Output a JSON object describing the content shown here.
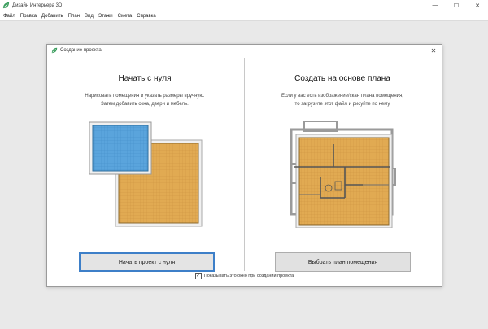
{
  "app": {
    "title": "Дизайн Интерьера 3D",
    "window_buttons": {
      "minimize": "—",
      "maximize": "☐",
      "close": "✕"
    }
  },
  "menu": {
    "items": [
      "Файл",
      "Правка",
      "Добавить",
      "План",
      "Вид",
      "Этажи",
      "Смета",
      "Справка"
    ]
  },
  "dialog": {
    "title": "Создание проекта",
    "close": "✕",
    "left": {
      "heading": "Начать с нуля",
      "desc_line1": "Нарисовать помещения и указать размеры вручную.",
      "desc_line2": "Затем добавить окна, двери и мебель.",
      "button": "Начать проект с нуля"
    },
    "right": {
      "heading": "Создать на основе плана",
      "desc_line1": "Если у вас есть изображение/скан плана помещения,",
      "desc_line2": "то загрузите этот файл и рисуйте по нему",
      "button": "Выбрать план помещения"
    },
    "checkbox": {
      "checked": true,
      "mark": "✓",
      "label": "Показывать это окно при создании проекта"
    }
  },
  "colors": {
    "room_fill": "#e1aa52",
    "room_fill_blue": "#5aa4dc",
    "accent": "#3d7fc8",
    "logo_green": "#3a9d5d"
  },
  "icons": {
    "app_logo": "leaf-logo-icon",
    "dialog_logo": "leaf-logo-icon"
  }
}
